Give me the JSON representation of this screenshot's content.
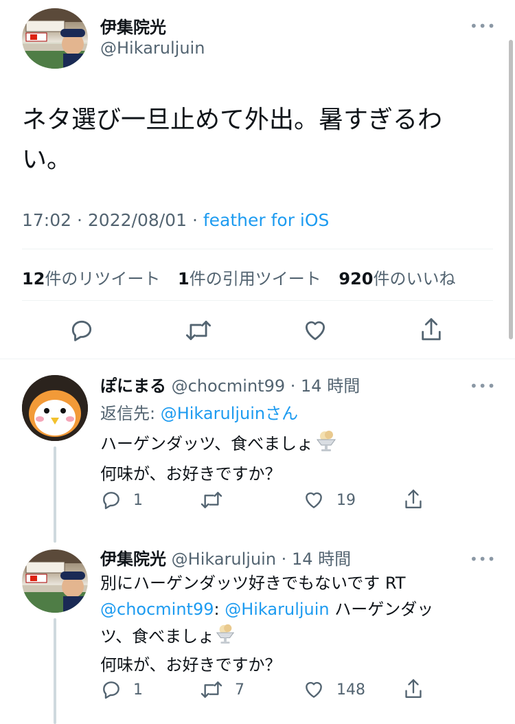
{
  "main_tweet": {
    "display_name": "伊集院光",
    "handle": "@Hikaruljuin",
    "text_line1": "ネタ選び一旦止めて外出。暑すぎるわ",
    "text_line2": "い。",
    "time": "17:02",
    "date": "2022/08/01",
    "source": "feather for iOS",
    "stats": {
      "retweets_count": "12",
      "retweets_label": "件のリツイート",
      "quotes_count": "1",
      "quotes_label": "件の引用ツイート",
      "likes_count": "920",
      "likes_label": "件のいいね"
    }
  },
  "replies": [
    {
      "display_name": "ぽにまる",
      "handle": "@chocmint99",
      "time": "14 時間",
      "reply_to_prefix": "返信先: ",
      "reply_to_handle": "@Hikaruljuin",
      "reply_to_suffix": "さん",
      "text_line1": "ハーゲンダッツ、食べましょ",
      "text_line2": "何味が、お好きですか？",
      "reply_count": "1",
      "retweet_count": "",
      "like_count": "19"
    },
    {
      "display_name": "伊集院光",
      "handle": "@Hikaruljuin",
      "time": "14 時間",
      "text_line1": "別にハーゲンダッツ好きでもないです RT",
      "mention1": "@chocmint99",
      "colon": ": ",
      "mention2": "@Hikaruljuin",
      "text_line2_rest": " ハーゲンダッ",
      "text_line3": "ツ、食べましょ",
      "text_line4": "何味が、お好きですか？",
      "reply_count": "1",
      "retweet_count": "7",
      "like_count": "148"
    }
  ],
  "icons": [
    "more-icon",
    "reply-icon",
    "retweet-icon",
    "like-icon",
    "share-icon",
    "ice-cream-emoji-icon"
  ],
  "colors": {
    "accent": "#1d9bf0",
    "text": "#0f1419",
    "secondary": "#536471"
  }
}
